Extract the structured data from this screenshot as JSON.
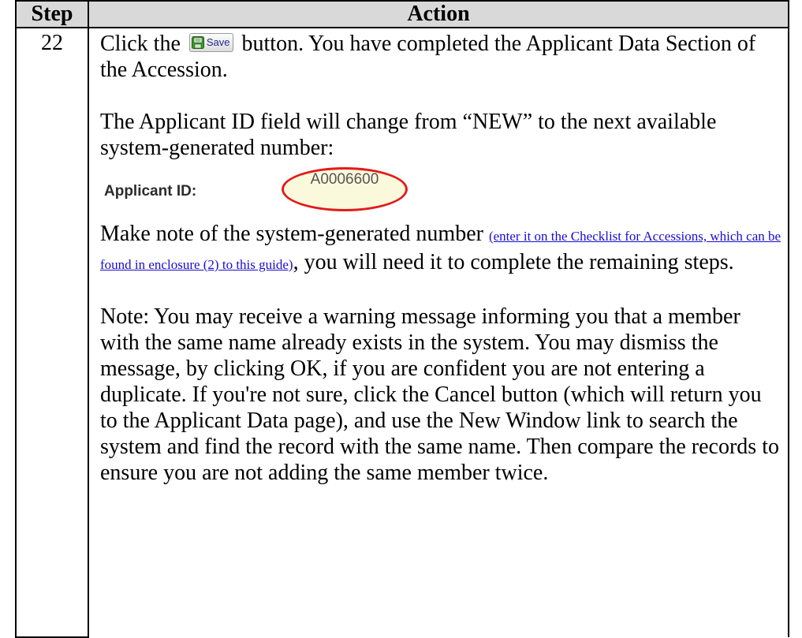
{
  "table": {
    "header_step": "Step",
    "header_action": "Action"
  },
  "row": {
    "step_number": "22",
    "p1_before": "Click the ",
    "save_button_label": "Save",
    "p1_after": " button.  You have completed the Applicant Data Section of the Accession.",
    "p2": "The Applicant ID field will change from “NEW” to the next available system-generated number:",
    "applicant_id_label": "Applicant ID:",
    "applicant_id_value": "A0006600",
    "p3_before": "Make note of the system-generated number ",
    "p3_link": "(enter it on the Checklist for Accessions, which can be found in enclosure (2) to this guide)",
    "p3_after": ", you will need it to complete the remaining steps.",
    "p4": "Note: You may receive a warning message informing you that a member with the same name already exists in the system. You may dismiss the message, by clicking OK, if you are confident you are not entering a duplicate. If you're not sure, click the Cancel button (which will return you to the Applicant Data page), and use the New Window link to search the system and find the record with the same name. Then compare the records to ensure you are not adding the same member twice."
  },
  "icons": {
    "save_icon": "floppy-disk-icon"
  },
  "colors": {
    "oval_border": "#e21b1b",
    "oval_fill": "#fbf9dc",
    "link": "#1a0dcc",
    "header_bg": "#d9d9d9"
  }
}
